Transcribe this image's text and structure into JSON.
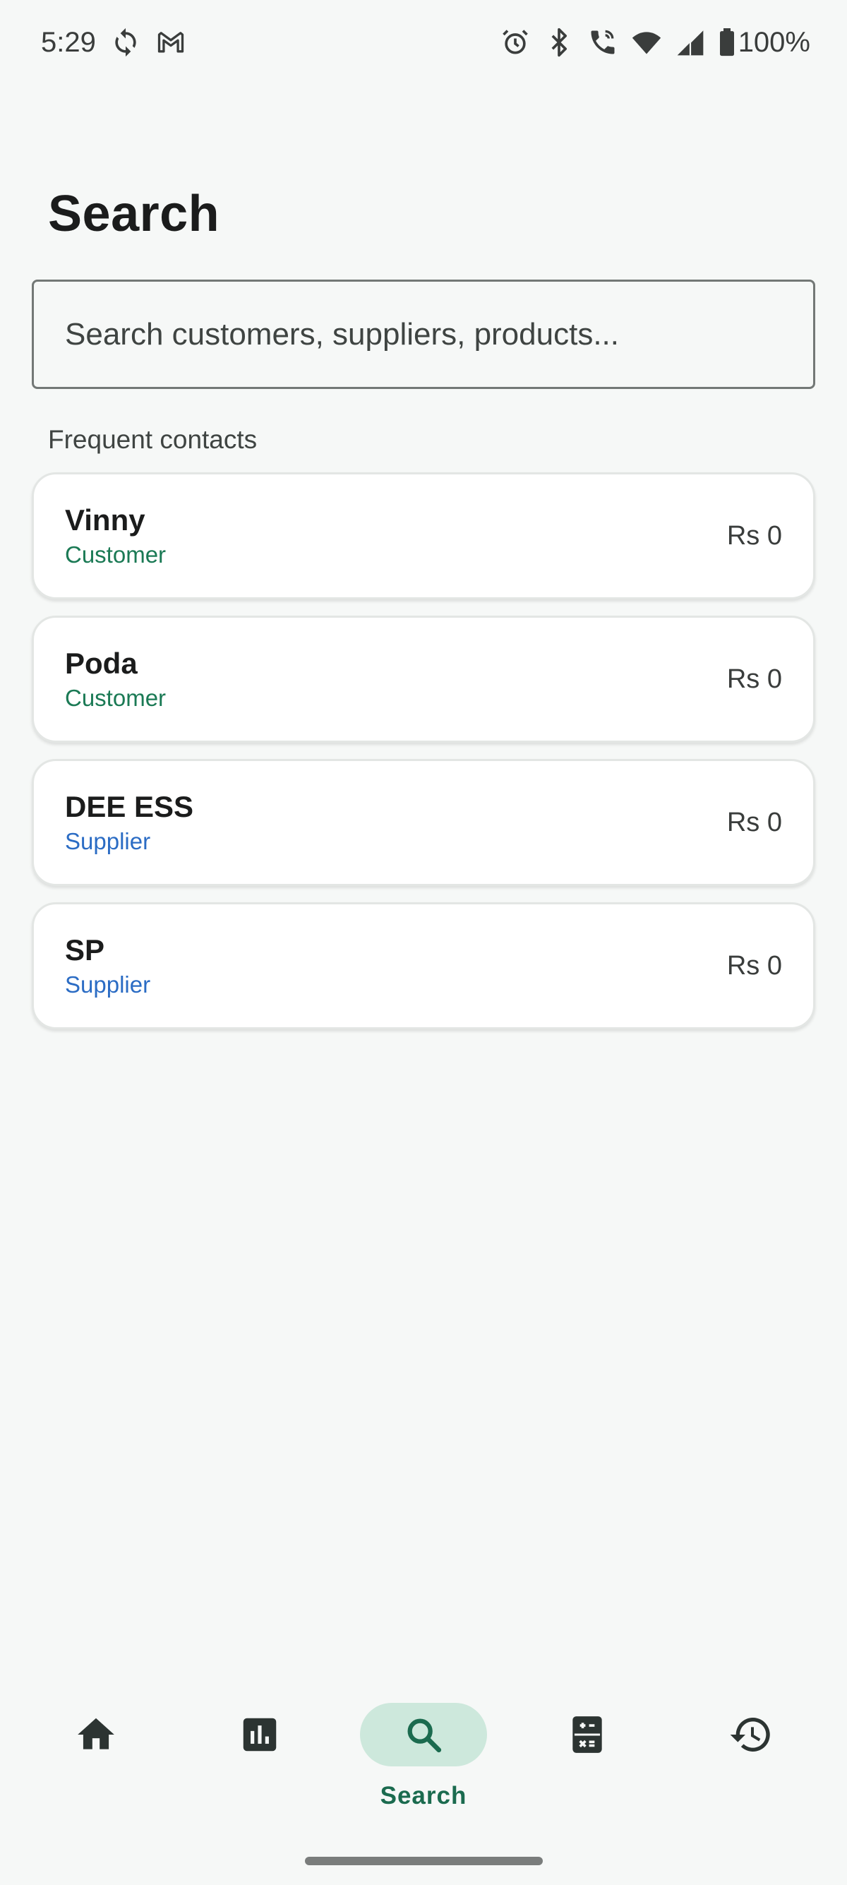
{
  "status_bar": {
    "time": "5:29",
    "battery": "100%",
    "left_icons": [
      "sync-icon",
      "gmail-icon"
    ],
    "right_icons": [
      "alarm-icon",
      "bluetooth-icon",
      "wifi-calling-icon",
      "wifi-icon",
      "signal-icon",
      "battery-icon"
    ]
  },
  "page": {
    "title": "Search"
  },
  "search": {
    "placeholder": "Search customers, suppliers, products..."
  },
  "frequent": {
    "label": "Frequent contacts",
    "contacts": [
      {
        "name": "Vinny",
        "type": "Customer",
        "amount": "Rs 0"
      },
      {
        "name": "Poda",
        "type": "Customer",
        "amount": "Rs 0"
      },
      {
        "name": "DEE ESS",
        "type": "Supplier",
        "amount": "Rs 0"
      },
      {
        "name": "SP",
        "type": "Supplier",
        "amount": "Rs 0"
      }
    ]
  },
  "bottom_nav": {
    "items": [
      {
        "icon": "home-icon",
        "label": ""
      },
      {
        "icon": "bar-chart-icon",
        "label": ""
      },
      {
        "icon": "search-icon",
        "label": "Search",
        "active": true
      },
      {
        "icon": "ledger-icon",
        "label": ""
      },
      {
        "icon": "history-icon",
        "label": ""
      }
    ]
  },
  "colors": {
    "background": "#f6f8f7",
    "customer": "#1b7a55",
    "supplier": "#2b6cc4",
    "active_pill": "#cde8dc",
    "active_label": "#1b6b4f"
  }
}
